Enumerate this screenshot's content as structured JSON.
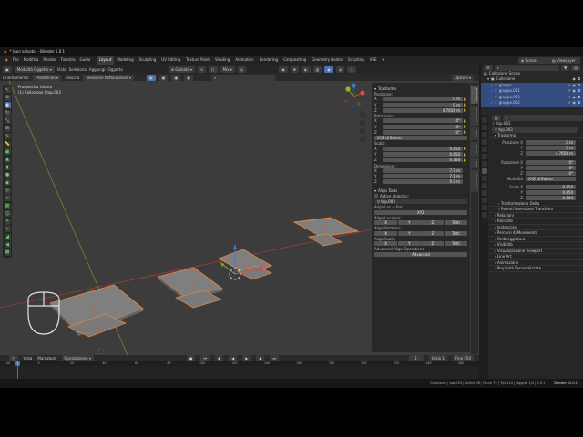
{
  "window": {
    "title": "* [non salvato] - Blender 5.0.1"
  },
  "menu": {
    "items": [
      "File",
      "Modifica",
      "Render",
      "Finestra",
      "Guida"
    ],
    "workspaces": [
      "Layout",
      "Modeling",
      "Sculpting",
      "UV Editing",
      "Texture Paint",
      "Shading",
      "Animation",
      "Rendering",
      "Compositing",
      "Geometry Nodes",
      "Scripting",
      "VSE"
    ],
    "active_workspace": "Layout",
    "scene_label": "Scena",
    "viewlayer_label": "ViewLayer"
  },
  "viewport_header": {
    "mode": "Modalità Oggetto",
    "menus": [
      "Vista",
      "Seleziona",
      "Aggiungi",
      "Oggetto"
    ],
    "orientation_label": "Orientamento:",
    "orientation_value": "Predefinito",
    "drag_label": "Trascina",
    "drag_value": "Selezione Rettangolare",
    "pivot": "Globale",
    "snap_label": "Mix",
    "options": "Opzioni"
  },
  "viewport": {
    "view_name": "Prospettiva Utente",
    "collection_info": "(1) Collezione | top.003"
  },
  "npanel": {
    "transform_title": "Trasforma",
    "location_label": "Posizione:",
    "location": {
      "x": "0 m",
      "y": "0 m",
      "z": "4.7654 m"
    },
    "rotation_label": "Rotazione:",
    "rotation": {
      "x": "0°",
      "y": "0°",
      "z": "0°"
    },
    "rotation_mode": "XYZ di Eulero",
    "scale_label": "Scala:",
    "scale": {
      "x": "0.850",
      "y": "0.850",
      "z": "0.100"
    },
    "dims_label": "Dimensioni:",
    "dims": {
      "x": "7.7 m",
      "y": "7.1 m",
      "z": "0.2 m"
    },
    "align_title": "Align Tools",
    "active_obj_label": "Active object is:",
    "active_obj_value": "top.003",
    "align_loc_rot": "Align Loc + Rot",
    "xyz_label": "XYZ",
    "align_location": "Align Location:",
    "align_rotation": "Align Rotation:",
    "align_scale": "Align Scale:",
    "x_label": "X",
    "y_label": "Y",
    "z_label": "Z",
    "all_label": "Tutti",
    "advanced_title": "Advanced Align Operations",
    "advanced_btn": "Advanced"
  },
  "ntabs": [
    "Elemento",
    "Strumento",
    "Vista",
    "Create",
    "Edit",
    "Animazione"
  ],
  "timeline": {
    "menus": [
      "Vista",
      "Marcatore"
    ],
    "playback": "Riproduzione",
    "frame_current": "1",
    "start_label": "Inizio",
    "start_value": "1",
    "end_label": "Fine",
    "end_value": "250",
    "ticks": [
      "-20",
      "0",
      "20",
      "40",
      "60",
      "80",
      "100",
      "120",
      "140",
      "160",
      "180",
      "200",
      "220",
      "240",
      "260"
    ]
  },
  "status": {
    "text": "Collezione | top.003 | Vertici 96 | Facce 72 | Tris 144 | Oggetti 1/4 | 5.0.1",
    "version": "Blender v5.0.1"
  },
  "outliner": {
    "search_placeholder": "",
    "root": "Collezione Scena",
    "collection": "Collezione",
    "items": [
      "groupo",
      "gruppo.001",
      "gruppo.003",
      "gruppo.002"
    ]
  },
  "properties": {
    "object_name": "top.003",
    "object_name2": "top.003",
    "transform_title": "Trasforma",
    "loc_label": "Posizione X",
    "loc": {
      "x": "0 m",
      "y": "0 m",
      "z": "4.7654 m"
    },
    "rot_label": "Rotazione X",
    "rot": {
      "x": "0°",
      "y": "0°",
      "z": "0°"
    },
    "mode_label": "Modalità",
    "mode_value": "XYZ di Eulero",
    "scale_label": "Scala X",
    "scale": {
      "x": "0.850",
      "y": "0.850",
      "z": "0.100"
    },
    "y_label": "Y",
    "z_label": "Z",
    "sections": [
      "Trasformazione Delta",
      "Parenti Inversione Transform",
      "Relazioni",
      "Raccolte",
      "Instancing",
      "Percorsi di Movimento",
      "Ombreggiatura",
      "Visibilità",
      "Visualizzazione Viewport",
      "Line Art",
      "Animazione",
      "Proprietà Personalizzate"
    ]
  },
  "colors": {
    "accent": "#4772b3",
    "selection_outline": "#e8853a",
    "outliner_selected": "#334d80"
  }
}
